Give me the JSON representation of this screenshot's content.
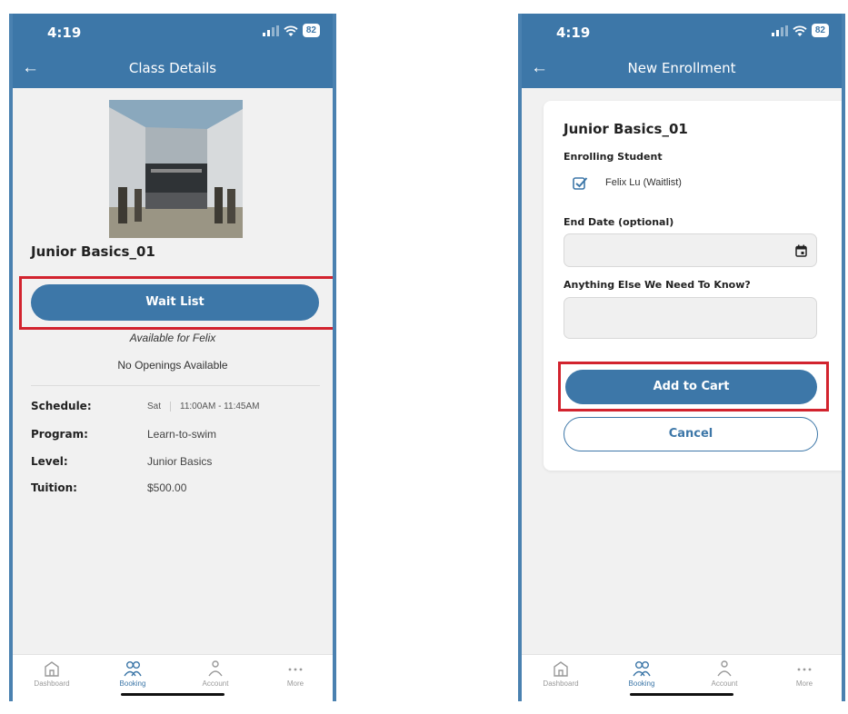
{
  "status": {
    "time": "4:19",
    "battery": "82"
  },
  "left": {
    "nav_title": "Class Details",
    "class_name": "Junior Basics_01",
    "wait_button": "Wait List",
    "available": "Available for Felix",
    "openings": "No Openings Available",
    "details": {
      "schedule_label": "Schedule:",
      "schedule_day": "Sat",
      "schedule_time": "11:00AM - 11:45AM",
      "program_label": "Program:",
      "program_value": "Learn-to-swim",
      "level_label": "Level:",
      "level_value": "Junior Basics",
      "tuition_label": "Tuition:",
      "tuition_value": "$500.00"
    }
  },
  "right": {
    "nav_title": "New Enrollment",
    "class_name": "Junior Basics_01",
    "enrolling_label": "Enrolling Student",
    "student": "Felix Lu  (Waitlist)",
    "end_date_label": "End Date (optional)",
    "notes_label": "Anything Else We Need To Know?",
    "add_button": "Add to Cart",
    "cancel_button": "Cancel"
  },
  "tabs": [
    {
      "label": "Dashboard",
      "icon": "home-icon",
      "active": false
    },
    {
      "label": "Booking",
      "icon": "people-icon",
      "active": true
    },
    {
      "label": "Account",
      "icon": "person-icon",
      "active": false
    },
    {
      "label": "More",
      "icon": "more-icon",
      "active": false
    }
  ],
  "colors": {
    "primary": "#3d77a8",
    "highlight": "#d2232e",
    "background": "#f1f1f1"
  }
}
